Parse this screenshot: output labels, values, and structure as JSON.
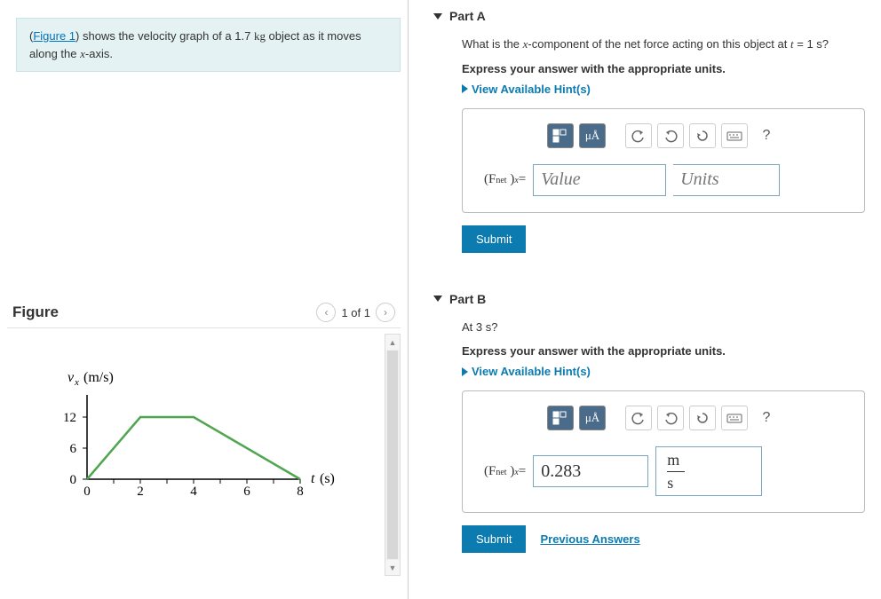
{
  "problem": {
    "link_text": "Figure 1",
    "text_before": "(",
    "text_after": ") shows the velocity graph of a 1.7 ",
    "unit_kg": "kg",
    "text_end": " object as it moves along the ",
    "var_x": "x",
    "axis_text": "-axis."
  },
  "figure": {
    "title": "Figure",
    "pager": "1 of 1"
  },
  "chart_data": {
    "type": "line",
    "title": "",
    "xlabel": "t (s)",
    "ylabel": "v_x (m/s)",
    "x": [
      0,
      2,
      4,
      8
    ],
    "y": [
      0,
      12,
      12,
      0
    ],
    "x_ticks": [
      0,
      2,
      4,
      6,
      8
    ],
    "y_ticks": [
      0,
      6,
      12
    ],
    "xlim": [
      0,
      8.5
    ],
    "ylim": [
      0,
      13
    ]
  },
  "partA": {
    "header": "Part A",
    "question_pre": "What is the ",
    "var_x": "x",
    "question_mid": "-component of the net force acting on this object at ",
    "var_t": "t",
    "eq": " = 1 s?",
    "instruction": "Express your answer with the appropriate units.",
    "hints": "View Available Hint(s)",
    "fnet_label": "(F",
    "fnet_sub": "net",
    "fnet_close": ")",
    "fnet_sub2": "x",
    "equals": " = ",
    "value_placeholder": "Value",
    "units_placeholder": "Units",
    "submit": "Submit",
    "mu_a": "μÅ",
    "help": "?"
  },
  "partB": {
    "header": "Part B",
    "question": "At 3 s?",
    "instruction": "Express your answer with the appropriate units.",
    "hints": "View Available Hint(s)",
    "value": "0.283",
    "unit_num": "m",
    "unit_den": "s",
    "submit": "Submit",
    "prev": "Previous Answers",
    "mu_a": "μÅ",
    "help": "?"
  }
}
